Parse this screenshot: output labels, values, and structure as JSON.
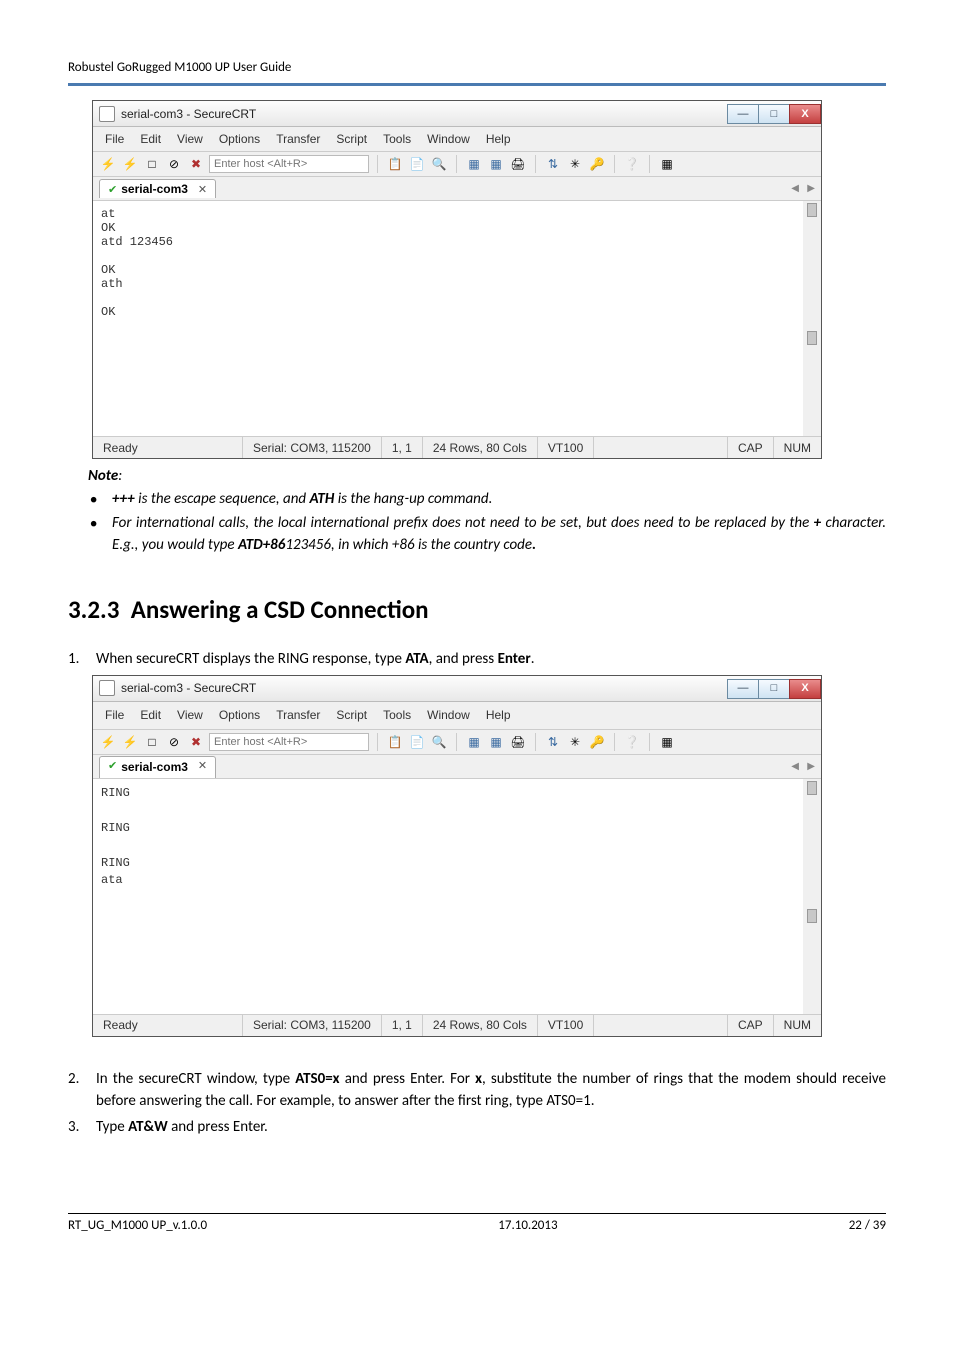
{
  "header": {
    "text": "Robustel GoRugged M1000 UP User Guide"
  },
  "win1": {
    "title": "serial-com3 - SecureCRT",
    "menus": [
      "File",
      "Edit",
      "View",
      "Options",
      "Transfer",
      "Script",
      "Tools",
      "Window",
      "Help"
    ],
    "host_placeholder": "Enter host <Alt+R>",
    "tab_label": "serial-com3",
    "terminal": "at\nOK\natd 123456\n\nOK\nath\n\nOK",
    "status": {
      "ready": "Ready",
      "serial": "Serial: COM3, 115200",
      "cursor": "1,  1",
      "size": "24 Rows, 80 Cols",
      "term": "VT100",
      "cap": "CAP",
      "num": "NUM"
    }
  },
  "note": {
    "label": "Note",
    "b1_pre": "+++",
    "b1_mid": " is the escape sequence, and ",
    "b1_bold": "ATH",
    "b1_post": " is the hang-up command.",
    "b2_pre": "For international calls, the local international prefix does not need to be set, but does need to be replaced by the ",
    "b2_plus": "+",
    "b2_mid": " character. E.g., you would type ",
    "b2_cmd": "ATD+86",
    "b2_post1": "123456, in which +86 is the country code",
    "b2_dot": "."
  },
  "section": {
    "num": "3.2.3",
    "title": "Answering a CSD Connection"
  },
  "step1": {
    "pre": "When secureCRT displays the RING response, type ",
    "cmd": "ATA",
    "mid": ", and press ",
    "enter": "Enter",
    "post": "."
  },
  "win2": {
    "title": "serial-com3 - SecureCRT",
    "menus": [
      "File",
      "Edit",
      "View",
      "Options",
      "Transfer",
      "Script",
      "Tools",
      "Window",
      "Help"
    ],
    "host_placeholder": "Enter host <Alt+R>",
    "tab_label": "serial-com3",
    "terminal": "RING\n\nRING\n\nRING\nata",
    "status": {
      "ready": "Ready",
      "serial": "Serial: COM3, 115200",
      "cursor": "1,  1",
      "size": "24 Rows, 80 Cols",
      "term": "VT100",
      "cap": "CAP",
      "num": "NUM"
    }
  },
  "step2": {
    "pre": "In the secureCRT window, type ",
    "cmd": "ATS0=x",
    "mid1": " and press Enter. For ",
    "x": "x",
    "mid2": ", substitute the number of rings that the modem should receive before answering the call. For example, to answer after the first ring, type ATS0=1."
  },
  "step3": {
    "pre": "Type ",
    "cmd": "AT&W",
    "post": " and press Enter."
  },
  "footer": {
    "left": "RT_UG_M1000 UP_v.1.0.0",
    "mid": "17.10.2013",
    "right": "22 / 39"
  }
}
